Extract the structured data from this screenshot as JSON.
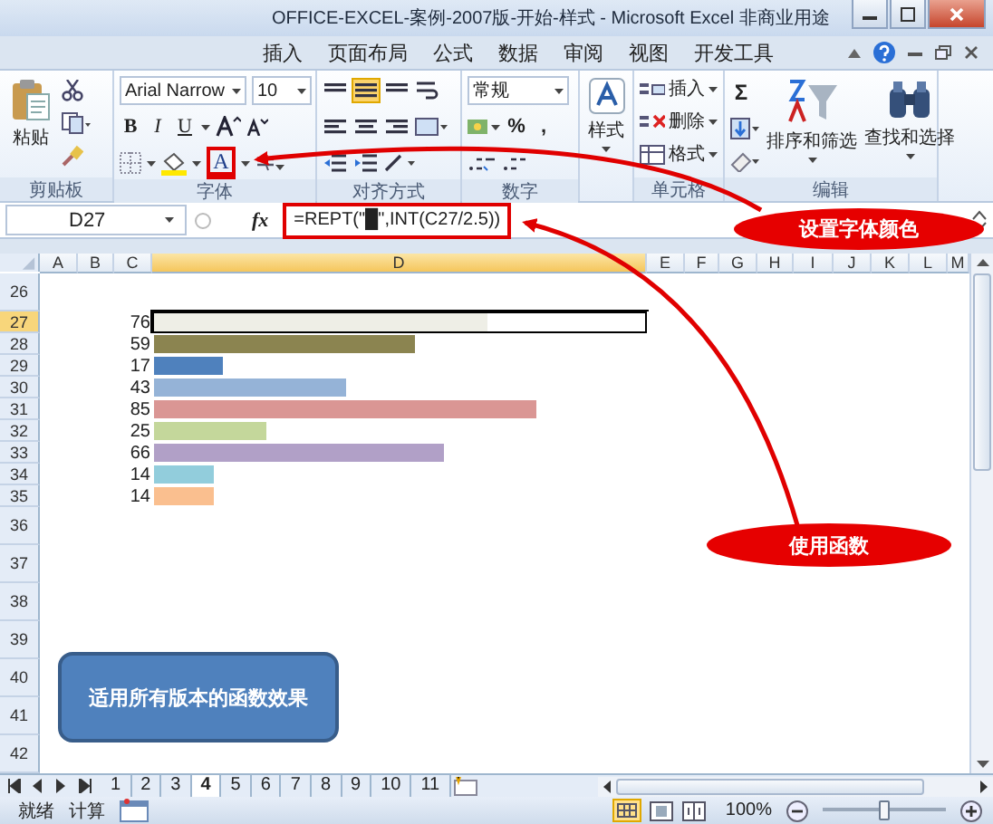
{
  "window": {
    "title": "OFFICE-EXCEL-案例-2007版-开始-样式 - Microsoft Excel 非商业用途"
  },
  "ribbon_tabs": [
    {
      "label": "插入"
    },
    {
      "label": "页面布局"
    },
    {
      "label": "公式"
    },
    {
      "label": "数据"
    },
    {
      "label": "审阅"
    },
    {
      "label": "视图"
    },
    {
      "label": "开发工具"
    }
  ],
  "ribbon": {
    "clipboard": {
      "paste": "粘贴",
      "label": "剪贴板"
    },
    "font": {
      "font_name": "Arial Narrow",
      "font_size": "10",
      "bold": "B",
      "italic": "I",
      "underline": "U",
      "font_color": "A",
      "label": "字体"
    },
    "alignment": {
      "label": "对齐方式"
    },
    "number": {
      "format": "常规",
      "percent": "%",
      "comma": ",",
      "label": "数字"
    },
    "styles": {
      "button": "样式"
    },
    "cells": {
      "items": [
        "插入",
        "删除",
        "格式"
      ],
      "label": "单元格"
    },
    "editing": {
      "sum": "Σ",
      "sort": "排序和筛选",
      "find": "查找和选择",
      "label": "编辑"
    }
  },
  "formula_bar": {
    "name_box": "D27",
    "fx": "fx",
    "formula": "=REPT(\"█\",INT(C27/2.5))"
  },
  "columns": [
    {
      "label": "A",
      "selected": false
    },
    {
      "label": "B",
      "selected": false
    },
    {
      "label": "C",
      "selected": false
    },
    {
      "label": "D",
      "selected": true
    },
    {
      "label": "E",
      "selected": false
    },
    {
      "label": "F",
      "selected": false
    },
    {
      "label": "G",
      "selected": false
    },
    {
      "label": "H",
      "selected": false
    },
    {
      "label": "I",
      "selected": false
    },
    {
      "label": "J",
      "selected": false
    },
    {
      "label": "K",
      "selected": false
    },
    {
      "label": "L",
      "selected": false
    },
    {
      "label": "M",
      "selected": false
    }
  ],
  "rows": [
    {
      "number": "26",
      "selected": false
    },
    {
      "number": "27",
      "value": "76",
      "level": 0.68,
      "color": "#eeeee6",
      "selected": true
    },
    {
      "number": "28",
      "value": "59",
      "level": 0.53,
      "color": "#8b8450",
      "selected": false
    },
    {
      "number": "29",
      "value": "17",
      "level": 0.14,
      "color": "#4f81bd",
      "selected": false
    },
    {
      "number": "30",
      "value": "43",
      "level": 0.39,
      "color": "#95b3d7",
      "selected": false
    },
    {
      "number": "31",
      "value": "85",
      "level": 0.78,
      "color": "#da9694",
      "selected": false
    },
    {
      "number": "32",
      "value": "25",
      "level": 0.23,
      "color": "#c4d79b",
      "selected": false
    },
    {
      "number": "33",
      "value": "66",
      "level": 0.59,
      "color": "#b1a0c7",
      "selected": false
    },
    {
      "number": "34",
      "value": "14",
      "level": 0.12,
      "color": "#92cddc",
      "selected": false
    },
    {
      "number": "35",
      "value": "14",
      "level": 0.12,
      "color": "#fabf8f",
      "selected": false
    },
    {
      "number": "36",
      "selected": false
    },
    {
      "number": "37",
      "selected": false
    },
    {
      "number": "38",
      "selected": false
    },
    {
      "number": "39",
      "selected": false
    },
    {
      "number": "40",
      "selected": false
    },
    {
      "number": "41",
      "selected": false
    },
    {
      "number": "42",
      "selected": false
    }
  ],
  "sheet_tabs": [
    {
      "label": "1",
      "selected": false
    },
    {
      "label": "2",
      "selected": false
    },
    {
      "label": "3",
      "selected": false
    },
    {
      "label": "4",
      "selected": true
    },
    {
      "label": "5",
      "selected": false
    },
    {
      "label": "6",
      "selected": false
    },
    {
      "label": "7",
      "selected": false
    },
    {
      "label": "8",
      "selected": false
    },
    {
      "label": "9",
      "selected": false
    },
    {
      "label": "10",
      "selected": false
    },
    {
      "label": "11",
      "selected": false
    }
  ],
  "status_bar": {
    "mode": "就绪",
    "calc": "计算",
    "zoom": "100%",
    "level": 0.5
  },
  "annotations": {
    "callouts": [
      {
        "text": "设置字体颜色"
      },
      {
        "text": "使用函数"
      }
    ],
    "note": "适用所有版本的函数效果"
  }
}
